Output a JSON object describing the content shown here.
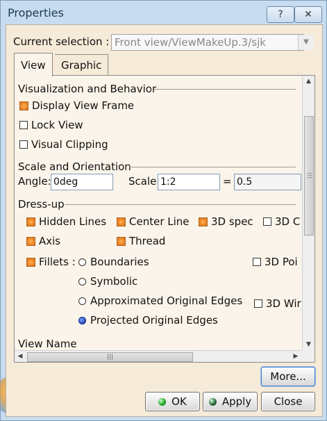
{
  "window": {
    "title": "Properties",
    "help_label": "?",
    "close_label": "✕"
  },
  "current_selection": {
    "label": "Current selection :",
    "value": "Front view/ViewMakeUp.3/sjk"
  },
  "tabs": [
    {
      "label": "View"
    },
    {
      "label": "Graphic"
    }
  ],
  "view_tab": {
    "visualization": {
      "header": "Visualization and Behavior",
      "display_view_frame": {
        "label": "Display View Frame",
        "checked": true
      },
      "lock_view": {
        "label": "Lock View",
        "checked": false
      },
      "visual_clipping": {
        "label": "Visual Clipping",
        "checked": false
      }
    },
    "scale_orientation": {
      "header": "Scale and Orientation",
      "angle_label": "Angle:",
      "angle_value": "0deg",
      "scale_label": "Scale:",
      "scale_value": "1:2",
      "equals": "=",
      "scale_result": "0.5"
    },
    "dressup": {
      "header": "Dress-up",
      "hidden_lines": {
        "label": "Hidden Lines",
        "checked": true
      },
      "center_line": {
        "label": "Center Line",
        "checked": true
      },
      "spec_3d": {
        "label": "3D spec",
        "checked": true
      },
      "col4_row1": {
        "label": "3D C",
        "checked": false
      },
      "axis": {
        "label": "Axis",
        "checked": true
      },
      "thread": {
        "label": "Thread",
        "checked": true
      },
      "fillets": {
        "label": "Fillets :",
        "checked": true
      },
      "col4_row3": {
        "label": "3D Poi",
        "checked": false
      },
      "col4_row5": {
        "label": "3D Wir",
        "checked": false
      },
      "fillet_options": [
        {
          "label": "Boundaries",
          "selected": false
        },
        {
          "label": "Symbolic",
          "selected": false
        },
        {
          "label": "Approximated Original Edges",
          "selected": false
        },
        {
          "label": "Projected Original Edges",
          "selected": true
        }
      ]
    },
    "view_name_header": "View Name"
  },
  "buttons": {
    "more": "More...",
    "ok": "OK",
    "apply": "Apply",
    "close": "Close"
  },
  "colors": {
    "client_bg": "#f6ead8",
    "checked_box": "#e06a10",
    "title_text": "#1e3953"
  }
}
